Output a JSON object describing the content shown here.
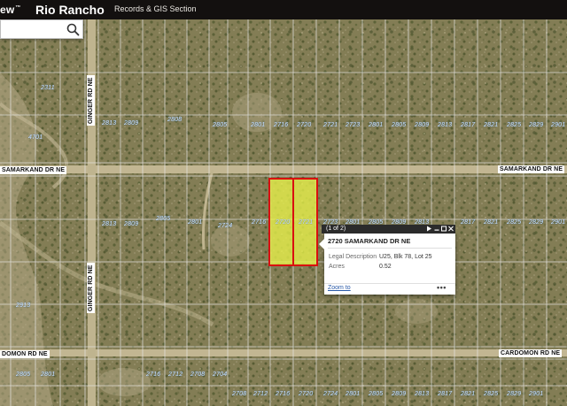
{
  "header": {
    "logo_text": "ew",
    "logo_mark": "™",
    "title": "Rio Rancho",
    "link": "Records & GIS Section",
    "colors": {
      "background": "#13100f",
      "text": "#ffffff"
    }
  },
  "search": {
    "value": "",
    "placeholder": "",
    "icon": "search-icon"
  },
  "map": {
    "type": "aerial-parcel-map",
    "roads": {
      "samarkand_left": "SAMARKAND DR NE",
      "samarkand_right": "SAMARKAND DR NE",
      "cardomon_left": "DOMON RD NE",
      "cardomon_right": "CARDOMON RD NE",
      "ginger_north": "GINGER RD NE",
      "ginger_south": "GINGER RD NE"
    },
    "colors": {
      "parcel_lines": "#e8e8e8",
      "selected_fill": "#e8f24a",
      "selected_outline": "#d90f0f",
      "lot_numbers": "#cfe6ff"
    },
    "lot_rows": {
      "north": [
        "2813",
        "2809",
        "2808",
        "2805",
        "2801",
        "2716",
        "2720",
        "2721",
        "2723",
        "2801",
        "2805",
        "2809",
        "2813",
        "2817",
        "2821",
        "2825",
        "2829",
        "2901"
      ],
      "south": [
        "2813",
        "2809",
        "2805",
        "2801",
        "2724",
        "2716",
        "2720",
        "2721",
        "2723",
        "2801",
        "2805",
        "2809",
        "2813",
        "2817",
        "2821",
        "2825",
        "2829",
        "2901"
      ],
      "bottom": [
        "2805",
        "2801",
        "2716",
        "2712",
        "2708",
        "2704",
        "2708",
        "2712",
        "2716",
        "2720",
        "2724",
        "2801",
        "2805",
        "2809",
        "2813",
        "2817",
        "2821",
        "2825",
        "2829",
        "2901"
      ],
      "west_col": [
        "2311",
        "4701",
        "2913"
      ]
    }
  },
  "popup": {
    "count": "(1 of 2)",
    "next_icon": "play-icon",
    "minimize_icon": "minimize-icon",
    "maximize_icon": "maximize-icon",
    "close_icon": "close-icon",
    "title": "2720 SAMARKAND DR NE",
    "fields": [
      {
        "label": "Legal Description",
        "value": "U25, Blk 78, Lot 25"
      },
      {
        "label": "Acres",
        "value": "0.52"
      }
    ],
    "zoom_link": "Zoom to",
    "more_icon": "ellipsis-icon",
    "more": "•••"
  }
}
